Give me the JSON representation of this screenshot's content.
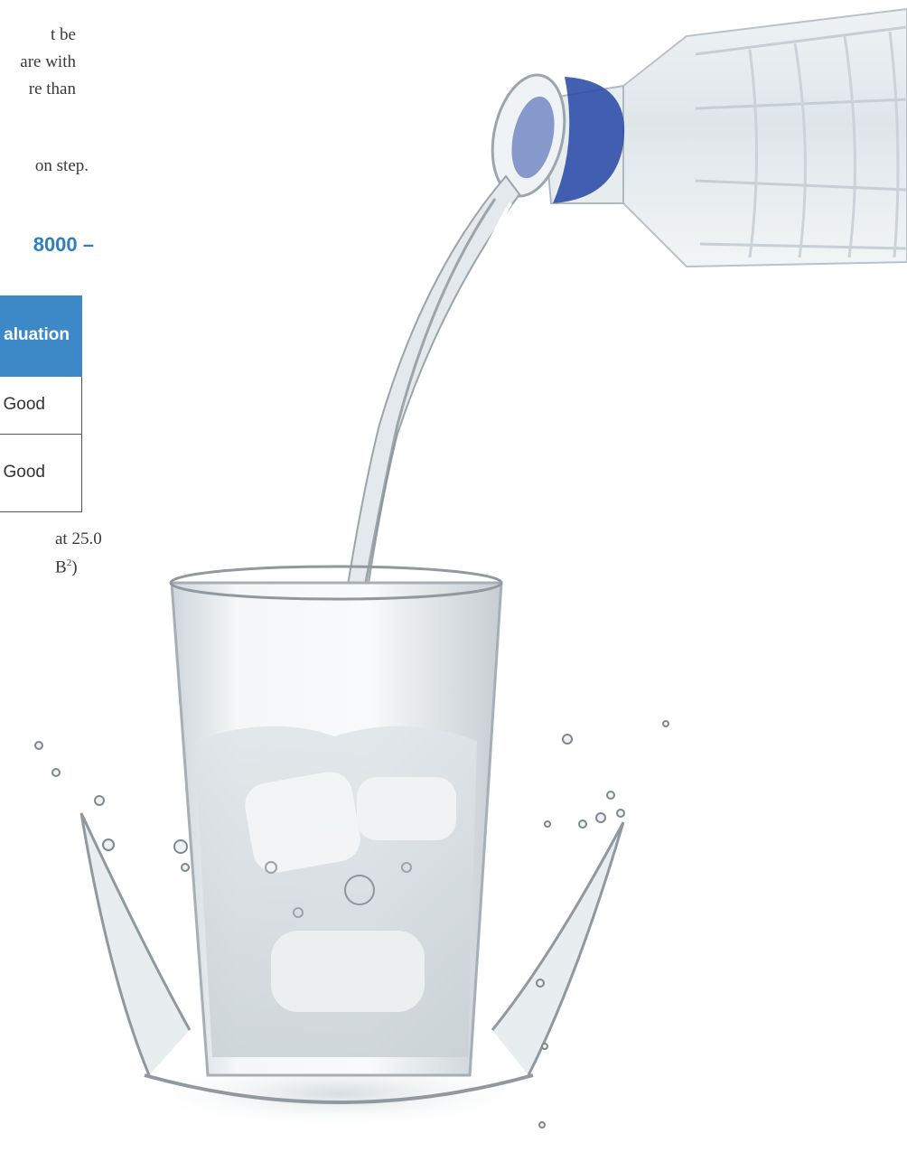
{
  "intro_lines": [
    "t be",
    "are with",
    "re than",
    "",
    "on step."
  ],
  "heading": "8000 –",
  "table": {
    "header": "aluation",
    "rows": [
      "Good",
      "Good"
    ]
  },
  "caption": {
    "line1": "at 25.0",
    "line2_prefix": "B",
    "sup": "2",
    "line2_suffix": ")"
  },
  "photo": {
    "subject": "water-pouring-photo",
    "colors": {
      "bottle_cap_ring": "#2f4fa8",
      "water": "#c9d6df",
      "heading_blue": "#2f7fbf",
      "table_header": "#3d88c7"
    }
  }
}
